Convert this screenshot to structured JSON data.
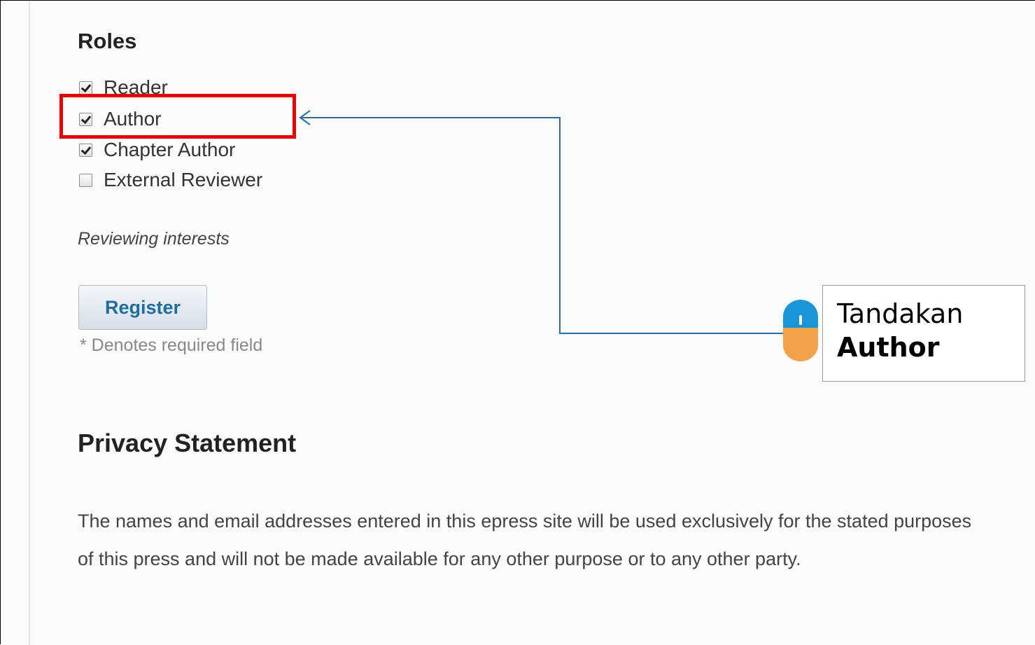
{
  "roles": {
    "title": "Roles",
    "items": [
      {
        "label": "Reader",
        "checked": true
      },
      {
        "label": "Author",
        "checked": true
      },
      {
        "label": "Chapter Author",
        "checked": true
      },
      {
        "label": "External Reviewer",
        "checked": false
      }
    ]
  },
  "reviewing_label": "Reviewing interests",
  "register_button": "Register",
  "required_note": "* Denotes required field",
  "privacy": {
    "title": "Privacy Statement",
    "text": "The names and email addresses entered in this epress site will be used exclusively for the stated purposes of this press and will not be made available for any other purpose or to any other party."
  },
  "annotation": {
    "line1": "Tandakan",
    "line2": "Author",
    "highlight_color": "#e60000",
    "connector_color": "#2e6da4",
    "icon": "mouse-click-icon"
  }
}
